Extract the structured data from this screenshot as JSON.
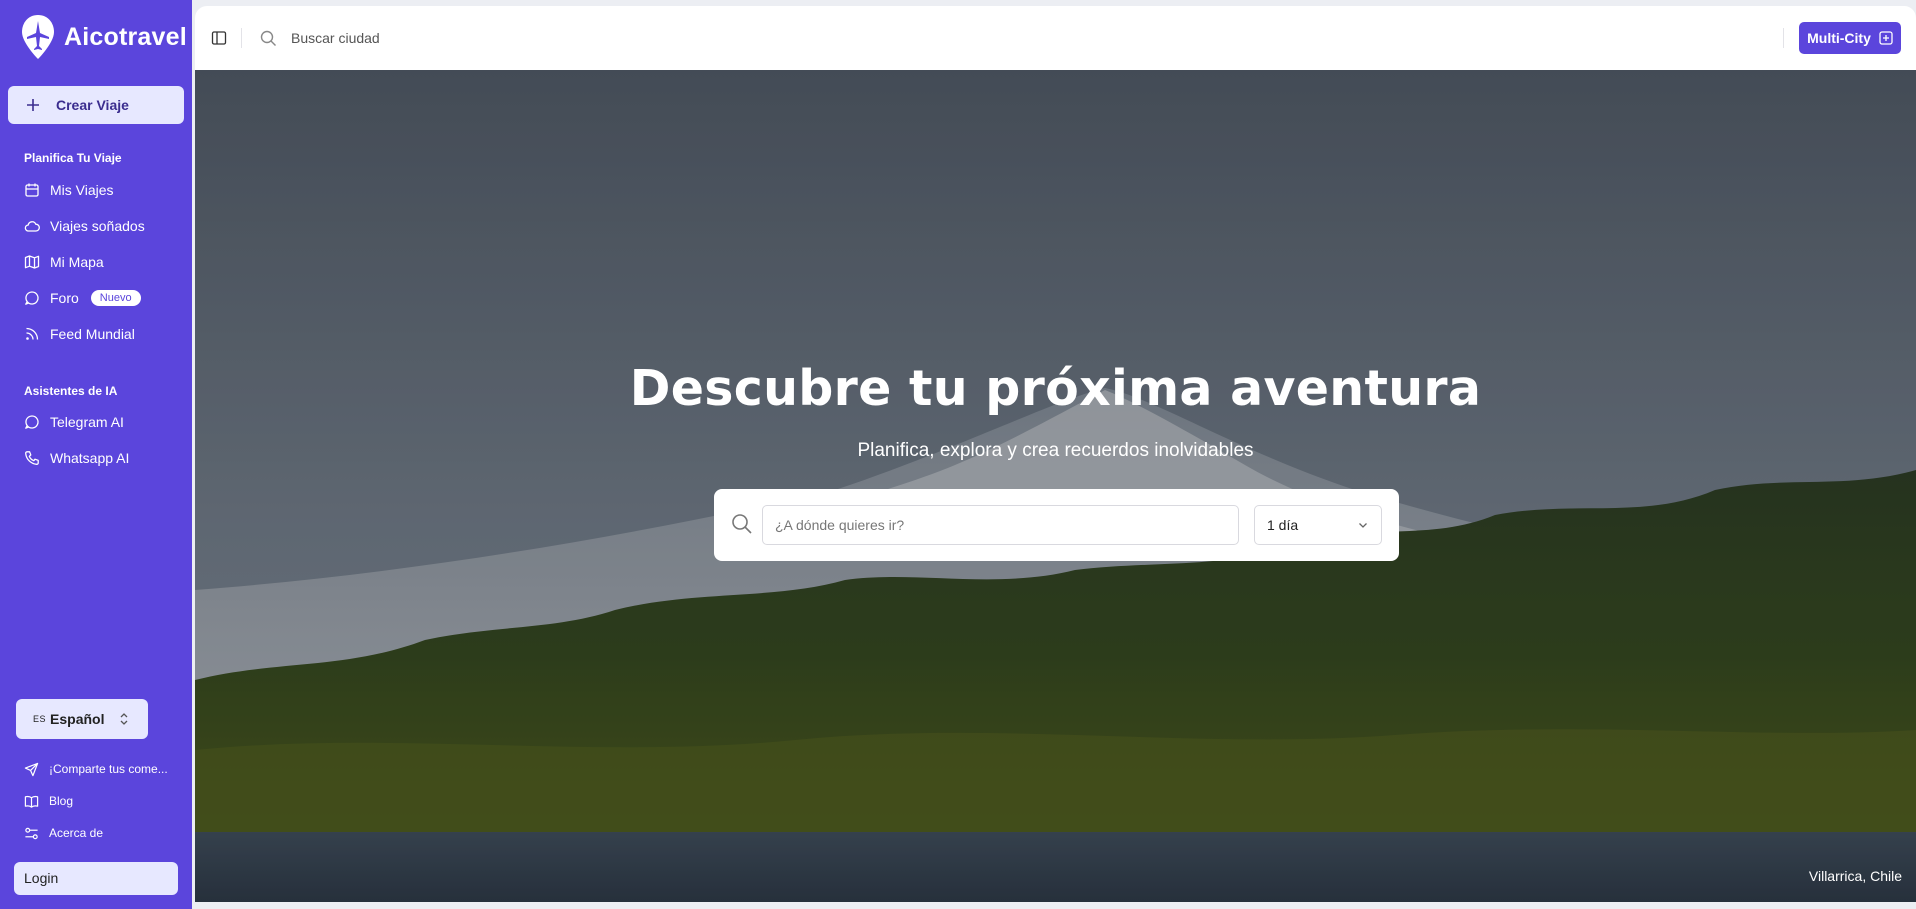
{
  "brand": {
    "name": "Aicotravel"
  },
  "sidebar": {
    "create_label": "Crear Viaje",
    "sections": [
      {
        "title": "Planifica Tu Viaje",
        "items": [
          {
            "label": "Mis Viajes",
            "icon": "calendar-icon"
          },
          {
            "label": "Viajes soñados",
            "icon": "cloud-icon"
          },
          {
            "label": "Mi Mapa",
            "icon": "map-icon"
          },
          {
            "label": "Foro",
            "icon": "chat-icon",
            "badge": "Nuevo"
          },
          {
            "label": "Feed Mundial",
            "icon": "rss-icon"
          }
        ]
      },
      {
        "title": "Asistentes de IA",
        "items": [
          {
            "label": "Telegram AI",
            "icon": "chat-icon"
          },
          {
            "label": "Whatsapp AI",
            "icon": "phone-icon"
          }
        ]
      }
    ],
    "language": {
      "code": "ES",
      "name": "Español"
    },
    "footer": [
      {
        "label": "¡Comparte tus come...",
        "icon": "send-icon"
      },
      {
        "label": "Blog",
        "icon": "book-icon"
      },
      {
        "label": "Acerca de",
        "icon": "sliders-icon"
      }
    ],
    "login_label": "Login"
  },
  "topbar": {
    "search_placeholder": "Buscar ciudad",
    "multicity_label": "Multi-City"
  },
  "hero": {
    "title": "Descubre tu próxima aventura",
    "subtitle": "Planifica, explora y crea recuerdos inolvidables",
    "destination_placeholder": "¿A dónde quieres ir?",
    "days_value": "1 día",
    "location": "Villarrica, Chile"
  },
  "colors": {
    "accent": "#5b45dc",
    "accent_light": "#e7e8ff"
  }
}
